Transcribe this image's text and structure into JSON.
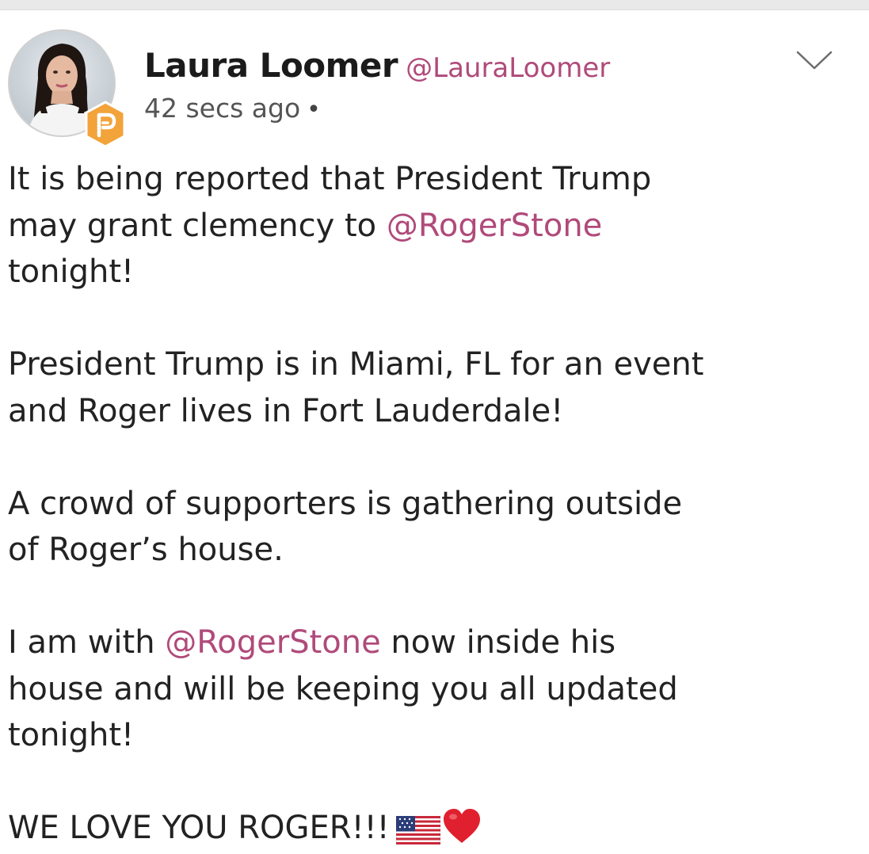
{
  "author": {
    "name": "Laura Loomer",
    "handle": "@LauraLoomer",
    "timestamp": "42 secs ago",
    "separator": "•",
    "badge_icon": "parler-p-badge-icon"
  },
  "colors": {
    "mention": "#b04a7a",
    "badge": "#f2a33a",
    "text": "#222222"
  },
  "post": {
    "p1": {
      "l1": "It is being reported that President Trump",
      "l2_pre": "may grant clemency to ",
      "l2_mention": "@RogerStone",
      "l3": "tonight!"
    },
    "p2": {
      "l1": "President Trump is in Miami, FL for an event",
      "l2": "and Roger lives in Fort Lauderdale!"
    },
    "p3": {
      "l1": "A crowd of supporters is gathering outside",
      "l2": "of Roger’s house."
    },
    "p4": {
      "l1_pre": "I am with ",
      "l1_mention": "@RogerStone",
      "l1_post": " now inside his",
      "l2": "house and will be keeping you all updated",
      "l3": "tonight!"
    },
    "p5": {
      "l1": "WE LOVE YOU ROGER!!!",
      "emojis": [
        "us-flag-icon",
        "red-heart-icon"
      ]
    }
  }
}
